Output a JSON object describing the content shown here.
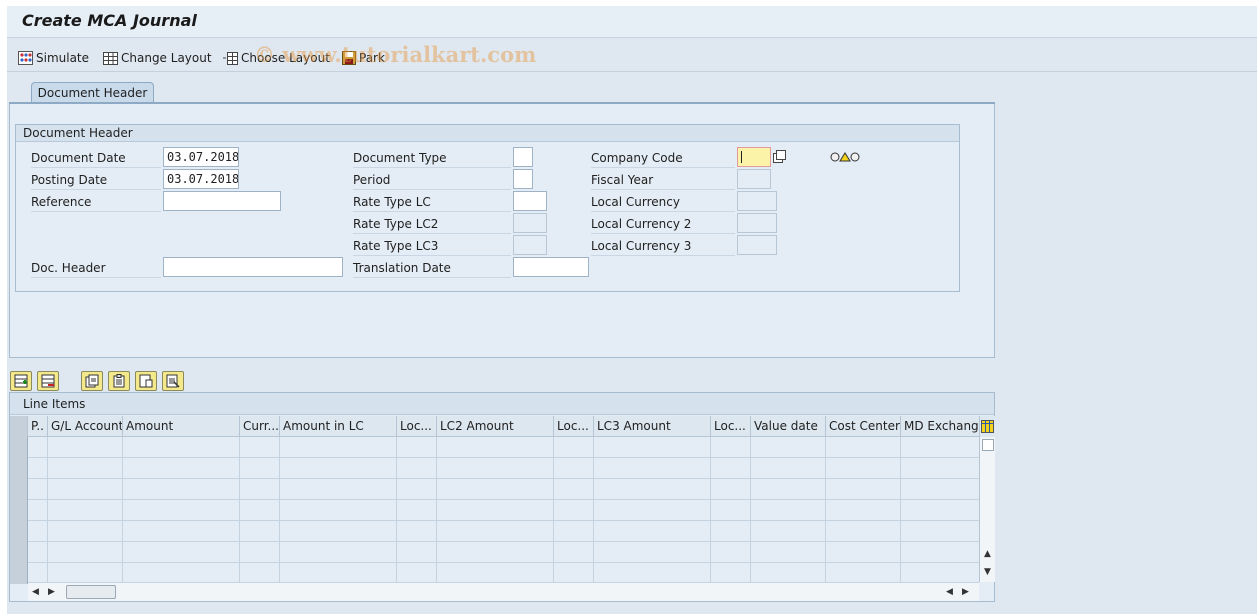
{
  "window": {
    "title": "Create MCA Journal"
  },
  "toolbar": {
    "simulate": "Simulate",
    "change_layout": "Change Layout",
    "choose_layout": "Choose Layout",
    "park": "Park"
  },
  "watermark": "© www.tutorialkart.com",
  "tabs": [
    {
      "label": "Document Header"
    }
  ],
  "header_group": {
    "title": "Document Header",
    "document_date": {
      "label": "Document Date",
      "value": "03.07.2018"
    },
    "posting_date": {
      "label": "Posting Date",
      "value": "03.07.2018"
    },
    "reference": {
      "label": "Reference",
      "value": ""
    },
    "doc_header": {
      "label": "Doc. Header",
      "value": ""
    },
    "document_type": {
      "label": "Document Type",
      "value": ""
    },
    "period": {
      "label": "Period",
      "value": ""
    },
    "rate_type_lc": {
      "label": "Rate Type LC",
      "value": ""
    },
    "rate_type_lc2": {
      "label": "Rate Type LC2",
      "value": ""
    },
    "rate_type_lc3": {
      "label": "Rate Type LC3",
      "value": ""
    },
    "translation_date": {
      "label": "Translation Date",
      "value": ""
    },
    "company_code": {
      "label": "Company Code",
      "value": ""
    },
    "fiscal_year": {
      "label": "Fiscal Year",
      "value": ""
    },
    "local_currency": {
      "label": "Local Currency",
      "value": ""
    },
    "local_currency_2": {
      "label": "Local Currency 2",
      "value": ""
    },
    "local_currency_3": {
      "label": "Local Currency 3",
      "value": ""
    }
  },
  "line_items": {
    "title": "Line Items",
    "columns": [
      "P..",
      "G/L Account",
      "Amount",
      "Curr...",
      "Amount in LC",
      "Loc...",
      "LC2 Amount",
      "Loc...",
      "LC3 Amount",
      "Loc...",
      "Value date",
      "Cost Center",
      "MD Exchange"
    ],
    "rows": 7
  },
  "colors": {
    "background": "#dfe8f1",
    "required_field": "#fbf3a8",
    "button_yellow": "#f4e98a"
  }
}
